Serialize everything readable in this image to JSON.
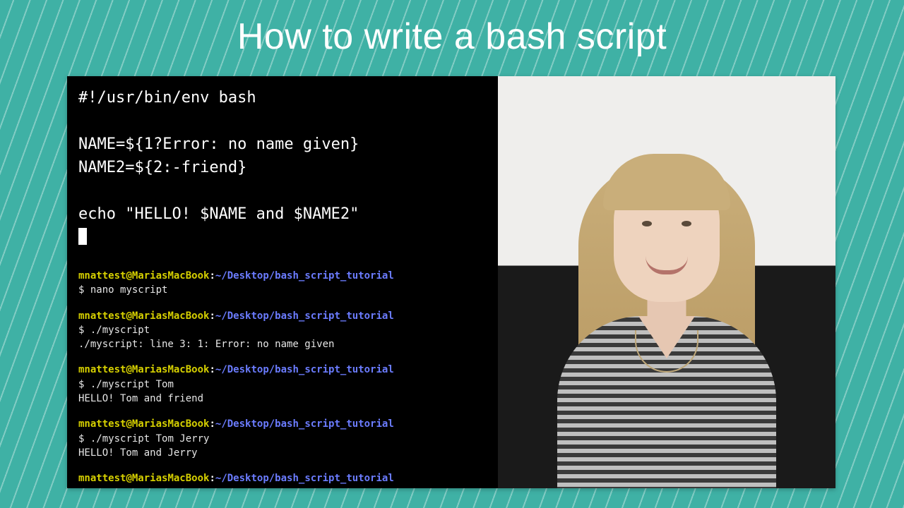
{
  "title": "How to write a bash script",
  "editor": {
    "lines": [
      "#!/usr/bin/env bash",
      "",
      "NAME=${1?Error: no name given}",
      "NAME2=${2:-friend}",
      "",
      "echo \"HELLO! $NAME and $NAME2\""
    ]
  },
  "terminal": {
    "user": "mnattest",
    "host": "MariasMacBook",
    "cwd": "~/Desktop/bash_script_tutorial",
    "prompt_symbol": "$",
    "sessions": [
      {
        "command": "nano myscript",
        "output": []
      },
      {
        "command": "./myscript",
        "output": [
          "./myscript: line 3: 1: Error: no name given"
        ]
      },
      {
        "command": "./myscript Tom",
        "output": [
          "HELLO! Tom and friend"
        ]
      },
      {
        "command": "./myscript Tom Jerry",
        "output": [
          "HELLO! Tom and Jerry"
        ]
      },
      {
        "command": "",
        "output": []
      }
    ]
  },
  "colors": {
    "background_teal": "#3fb1a5",
    "prompt_user": "#d6d000",
    "prompt_path": "#6b7cff",
    "terminal_bg": "#000000",
    "terminal_fg": "#ffffff"
  }
}
